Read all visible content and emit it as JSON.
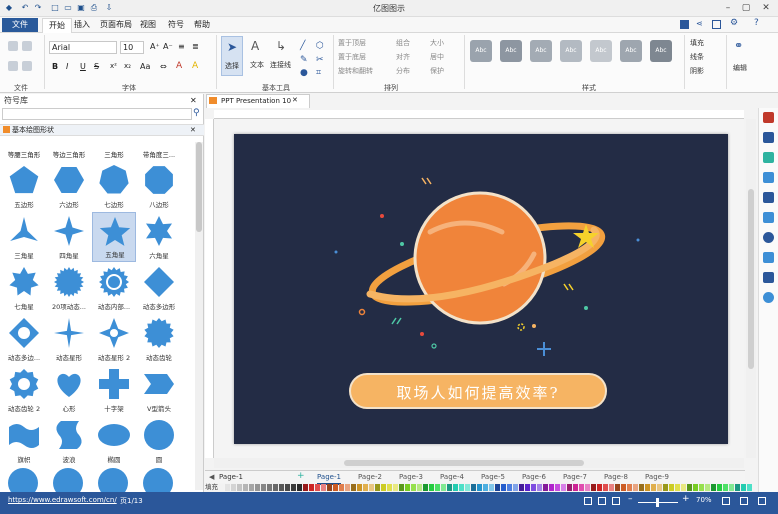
{
  "app": {
    "title": "亿图图示"
  },
  "menu": {
    "file": "文件",
    "tabs": [
      "开始",
      "插入",
      "页面布局",
      "视图",
      "符号",
      "帮助"
    ]
  },
  "ribbon": {
    "font_name": "Arial",
    "font_size": "10",
    "groups": {
      "file": "文件",
      "font": "字体",
      "tools": "基本工具",
      "arrange": "排列",
      "style": "样式"
    },
    "tools": {
      "select": "选择",
      "text": "文本",
      "connector": "连接线"
    },
    "arrange": [
      "置于顶层",
      "置于底层",
      "旋转和翻转",
      "组合",
      "对齐",
      "分布",
      "大小",
      "居中",
      "保护"
    ],
    "style_btn": "Abc",
    "style_colors": [
      "#9aa3ad",
      "#8d96a1",
      "#a3abb4",
      "#b3bac2",
      "#c3c8ce",
      "#9ea6af",
      "#7e8791"
    ],
    "fill": [
      "填充",
      "线条",
      "阴影"
    ],
    "edit": "编辑"
  },
  "library": {
    "title": "符号库",
    "section": "基本绘图形状",
    "top_labels": [
      "等腰三角形",
      "等边三角形",
      "三角形",
      "带角度三..."
    ],
    "shapes": [
      {
        "label": "五边形",
        "icon": "pentagon"
      },
      {
        "label": "六边形",
        "icon": "hexagon"
      },
      {
        "label": "七边形",
        "icon": "heptagon"
      },
      {
        "label": "八边形",
        "icon": "octagon"
      },
      {
        "label": "三角星",
        "icon": "star3"
      },
      {
        "label": "四角星",
        "icon": "star4"
      },
      {
        "label": "五角星",
        "icon": "star5"
      },
      {
        "label": "六角星",
        "icon": "star6"
      },
      {
        "label": "七角星",
        "icon": "star7"
      },
      {
        "label": "20项动态...",
        "icon": "star20"
      },
      {
        "label": "动态内部...",
        "icon": "burst"
      },
      {
        "label": "动态多边形",
        "icon": "diamond"
      },
      {
        "label": "动态多边...",
        "icon": "ring-diamond"
      },
      {
        "label": "动态星形",
        "icon": "star4-slim"
      },
      {
        "label": "动态星形 2",
        "icon": "star4-ring"
      },
      {
        "label": "动态齿轮",
        "icon": "gear"
      },
      {
        "label": "动态齿轮 2",
        "icon": "gear2"
      },
      {
        "label": "心形",
        "icon": "heart"
      },
      {
        "label": "十字架",
        "icon": "cross"
      },
      {
        "label": "V型箭头",
        "icon": "chevron"
      },
      {
        "label": "旗帜",
        "icon": "flag"
      },
      {
        "label": "波浪",
        "icon": "wave"
      },
      {
        "label": "椭圆",
        "icon": "ellipse"
      },
      {
        "label": "圆",
        "icon": "circle"
      }
    ]
  },
  "document": {
    "tab": "PPT Presentation 10"
  },
  "slide": {
    "banner": "取场人如何提高效率?"
  },
  "pages": {
    "current_selector": "Page-1",
    "tabs": [
      "Page-1",
      "Page-2",
      "Page-3",
      "Page-4",
      "Page-5",
      "Page-6",
      "Page-7",
      "Page-8",
      "Page-9"
    ]
  },
  "colorbar": {
    "label": "填充"
  },
  "status": {
    "url": "https://www.edrawsoft.com/cn/",
    "page": "页1/13",
    "zoom": "70%"
  },
  "accent": "#2b579a",
  "shape_color": "#3d8fd6"
}
